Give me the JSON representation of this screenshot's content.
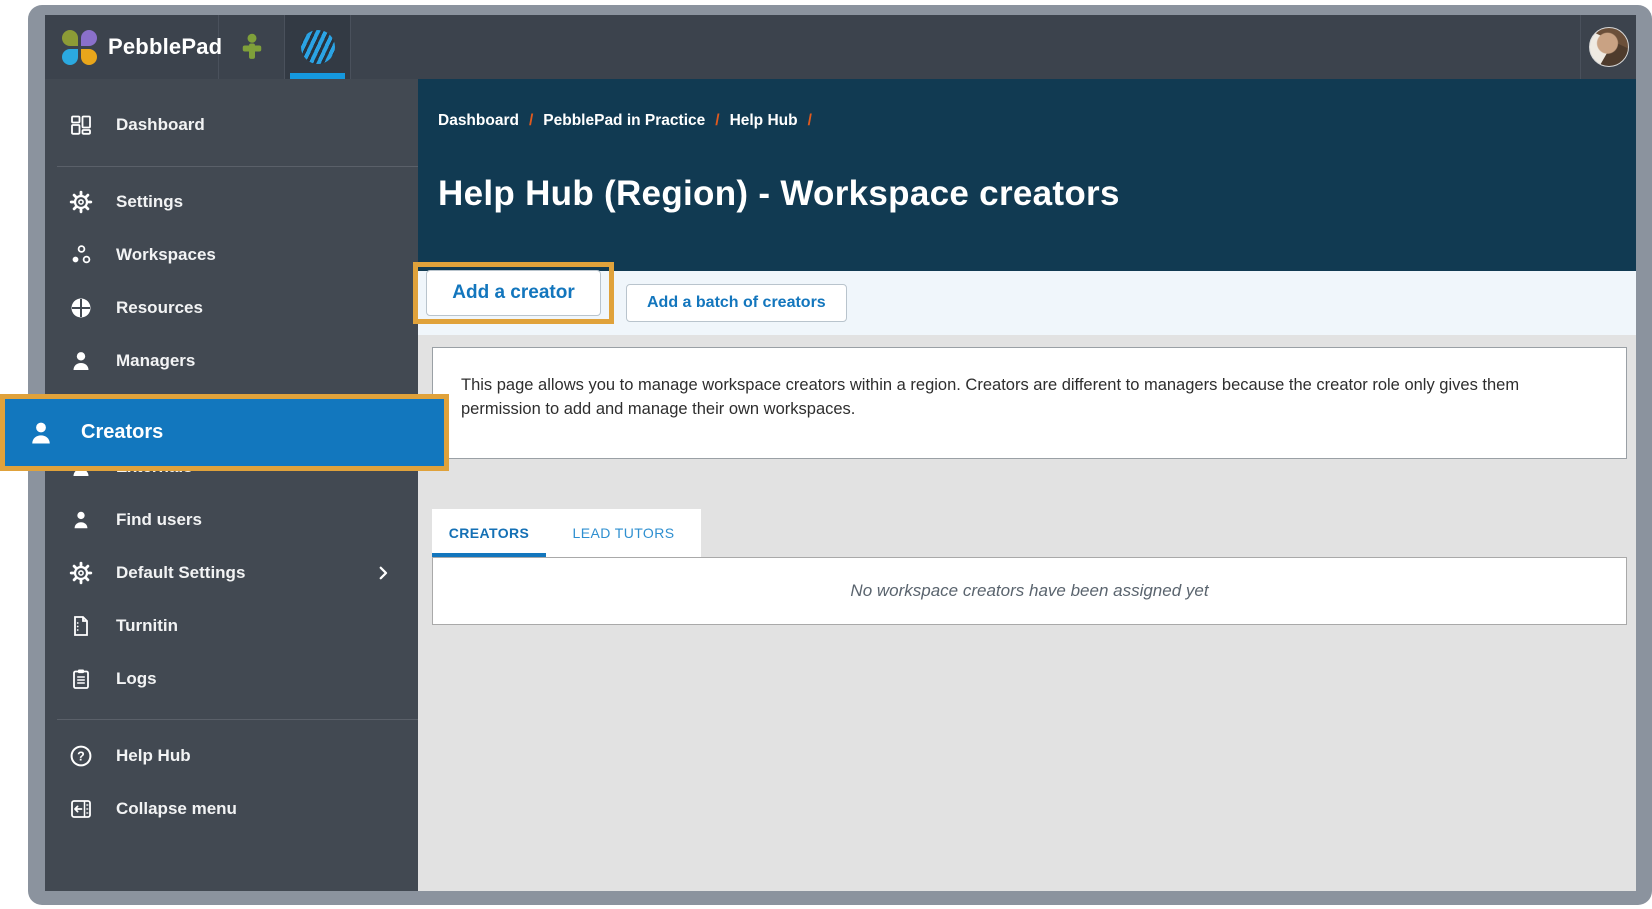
{
  "topbar": {
    "logo_text": "PebblePad"
  },
  "sidebar": {
    "items": [
      {
        "label": "Dashboard"
      },
      {
        "label": "Settings"
      },
      {
        "label": "Workspaces"
      },
      {
        "label": "Resources"
      },
      {
        "label": "Managers"
      },
      {
        "label": "Creators",
        "active": true,
        "highlighted": true
      },
      {
        "label": "Externals"
      },
      {
        "label": "Find users"
      },
      {
        "label": "Default Settings",
        "has_submenu": true
      },
      {
        "label": "Turnitin"
      },
      {
        "label": "Logs"
      },
      {
        "label": "Help Hub"
      },
      {
        "label": "Collapse menu"
      }
    ]
  },
  "header": {
    "breadcrumb": [
      "Dashboard",
      "PebblePad in Practice",
      "Help Hub"
    ],
    "separator": "/",
    "title": "Help Hub (Region) - Workspace creators"
  },
  "actions": {
    "primary": "Add a creator",
    "secondary": "Add a batch of creators"
  },
  "info_text": "This page allows you to manage workspace creators within a region. Creators are different to managers because the creator role only gives them permission to add and manage their own workspaces.",
  "tabs": [
    {
      "label": "CREATORS",
      "active": true
    },
    {
      "label": "LEAD TUTORS",
      "active": false
    }
  ],
  "empty_message": "No workspace creators have been assigned yet",
  "icons": {
    "help_glyph": "?"
  },
  "colors": {
    "annotation_highlight": "#E0A23B",
    "active_item_blue": "#1277BE",
    "header_navy": "#113A52",
    "accent_blue": "#1376BD",
    "breadcrumb_separator_orange": "#E05A1E",
    "topbar_dark": "#3C434D",
    "sidebar_dark": "#424952",
    "content_gray": "#E2E2E2",
    "frame_gray": "#8B939E"
  }
}
